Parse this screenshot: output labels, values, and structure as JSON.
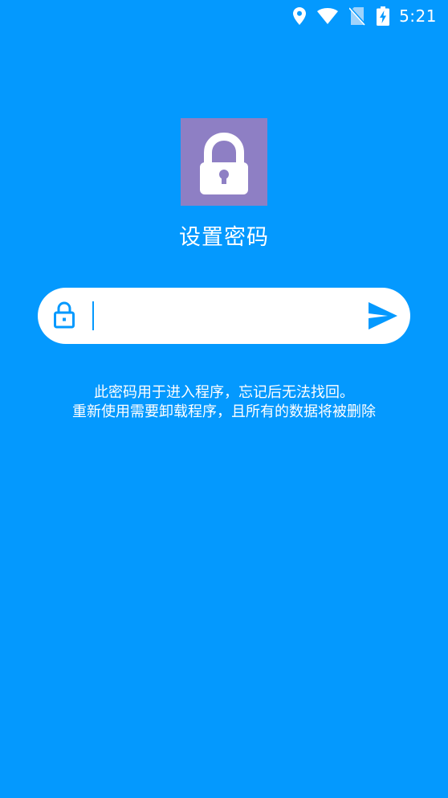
{
  "status_bar": {
    "time": "5:21",
    "icons": [
      "location-icon",
      "wifi-icon",
      "no-sim-icon",
      "battery-charging-icon"
    ]
  },
  "logo": {
    "icon": "padlock-icon",
    "background": "#8e7fc4"
  },
  "title": "设置密码",
  "password_field": {
    "value": "",
    "placeholder": "",
    "lock_icon": "lock-icon",
    "send_icon": "send-icon"
  },
  "hint": {
    "line1": "此密码用于进入程序，忘记后无法找回。",
    "line2": "重新使用需要卸载程序，且所有的数据将被删除"
  },
  "colors": {
    "background": "#0499fe",
    "accent": "#0499fe",
    "logo_bg": "#8e7fc4"
  }
}
